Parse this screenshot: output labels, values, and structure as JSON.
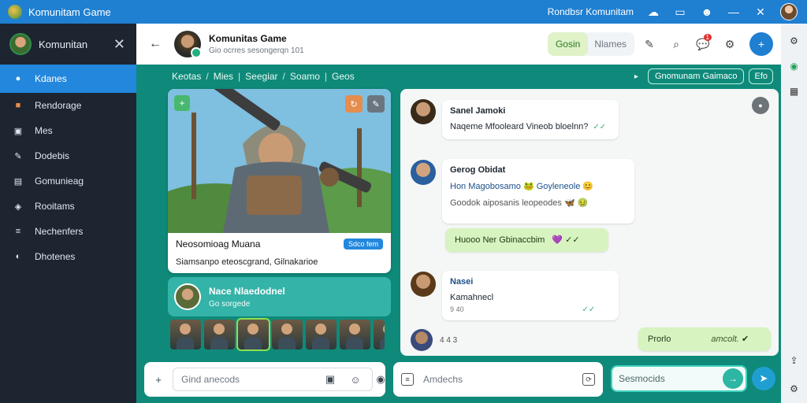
{
  "window": {
    "title": "Komunitam Game",
    "right_label": "Rondbsr Komunitam",
    "icons": [
      "cloud-icon",
      "window-icon",
      "avatar-icon",
      "minimize-icon",
      "close-icon",
      "profile-icon"
    ]
  },
  "sidebar": {
    "name": "Komunitan",
    "items": [
      {
        "label": "Kdanes",
        "icon": "home-icon",
        "active": true
      },
      {
        "label": "Rendorage",
        "icon": "chart-icon"
      },
      {
        "label": "Mes",
        "icon": "message-icon"
      },
      {
        "label": "Dodebis",
        "icon": "edit-icon"
      },
      {
        "label": "Gomunieag",
        "icon": "community-icon"
      },
      {
        "label": "Rooitams",
        "icon": "tag-icon"
      },
      {
        "label": "Nechenfers",
        "icon": "list-icon"
      },
      {
        "label": "Dhotenes",
        "icon": "settings-icon"
      }
    ]
  },
  "header": {
    "title": "Komunitas Game",
    "subtitle": "Gio ocrres sesongerqn 101",
    "toggle_on": "Gosin",
    "toggle_off": "Nlames",
    "badge": "1",
    "icons": [
      "pen-icon",
      "search-icon",
      "chat-icon",
      "bug-icon",
      "add-icon"
    ]
  },
  "filterbar": {
    "crumbs": [
      "Keotas",
      "Mies",
      "Seegiar",
      "Soamo",
      "Geos"
    ],
    "pill": "Gnomunam Gaimaco",
    "pill2": "Efo"
  },
  "feature": {
    "title": "Neosomioag Muana",
    "tag": "Sdco fem",
    "desc": "Siamsanpo eteoscgrand, Gilnakarioe"
  },
  "member": {
    "name": "Nace Nlaedodnel",
    "sub": "Go sorgede"
  },
  "chat": {
    "messages": [
      {
        "who": "Sanel Jamoki",
        "text": "Naqeme Mfooleard Vineob bloelnn?",
        "tick": "✓✓"
      },
      {
        "who": "Gerog Obidat",
        "text": "Hon Magobosamo 🐸 Goyleneole 😊",
        "text2": "Goodok aiposanis leopeodes 🦋 🤢"
      },
      {
        "green": true,
        "text": "Huooo Ner Gbinaccbim",
        "emoji": "💜",
        "tick": "✓✓"
      },
      {
        "who": "Nasei",
        "text": "Kamahnecl",
        "time": "9 40",
        "tick": "✓✓"
      },
      {
        "time": "4 4 3"
      },
      {
        "green": true,
        "text": "Prorlo",
        "trail": "amcolt."
      }
    ]
  },
  "composer": {
    "left_placeholder": "Gind anecods",
    "mid_placeholder": "Amdechs",
    "search_placeholder": "Sesmocids"
  },
  "rail": {
    "icons": [
      "settings-icon",
      "globe-icon",
      "clipboard-icon",
      "share-icon",
      "gear-icon"
    ]
  }
}
